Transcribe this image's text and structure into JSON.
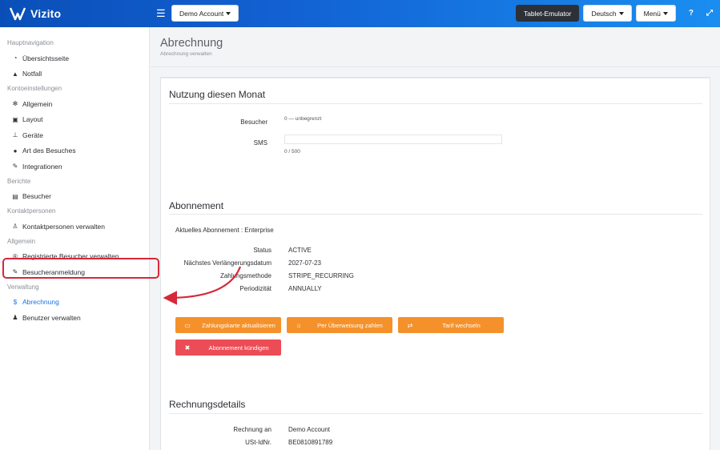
{
  "header": {
    "brand": "Vizito",
    "account_button": "Demo Account",
    "tablet_emulator": "Tablet-Emulator",
    "language": "Deutsch",
    "menu": "Menü",
    "help_icon": "?",
    "expand_icon": "⤢"
  },
  "sidebar": {
    "sections": [
      {
        "title": "Hauptnavigation",
        "items": [
          {
            "label": "Übersichtsseite",
            "icon": "gauge-icon"
          },
          {
            "label": "Notfall",
            "icon": "warning-icon"
          }
        ]
      },
      {
        "title": "Kontoeinstellungen",
        "items": [
          {
            "label": "Allgemein",
            "icon": "gear-icon"
          },
          {
            "label": "Layout",
            "icon": "image-icon"
          },
          {
            "label": "Geräte",
            "icon": "sitemap-icon"
          },
          {
            "label": "Art des Besuches",
            "icon": "users-icon"
          },
          {
            "label": "Integrationen",
            "icon": "plug-icon"
          }
        ]
      },
      {
        "title": "Berichte",
        "items": [
          {
            "label": "Besucher",
            "icon": "book-icon"
          }
        ]
      },
      {
        "title": "Kontaktpersonen",
        "items": [
          {
            "label": "Kontaktpersonen verwalten",
            "icon": "person-icon"
          }
        ]
      },
      {
        "title": "Allgemein",
        "items": [
          {
            "label": "Registrierte Besucher verwalten",
            "icon": "registered-icon"
          },
          {
            "label": "Besucheranmeldung",
            "icon": "pen-icon"
          }
        ]
      },
      {
        "title": "Verwaltung",
        "items": [
          {
            "label": "Abrechnung",
            "icon": "dollar-icon"
          },
          {
            "label": "Benutzer verwalten",
            "icon": "user-cog-icon"
          }
        ]
      }
    ]
  },
  "page": {
    "title": "Abrechnung",
    "subtitle": "Abrechnung verwalten"
  },
  "usage": {
    "title": "Nutzung diesen Monat",
    "visitors_label": "Besucher",
    "visitors_value": "0 — unbegrenzt",
    "sms_label": "SMS",
    "sms_value": "0 / 500",
    "sms_fraction": 0
  },
  "subscription": {
    "title": "Abonnement",
    "current": "Aktuelles Abonnement : Enterprise",
    "rows": [
      {
        "label": "Status",
        "value": "ACTIVE"
      },
      {
        "label": "Nächstes Verlängerungsdatum",
        "value": "2027-07-23"
      },
      {
        "label": "Zahlungsmethode",
        "value": "STRIPE_RECURRING"
      },
      {
        "label": "Periodizität",
        "value": "ANNUALLY"
      }
    ],
    "buttons": {
      "update_card": "Zahlungskarte aktualisieren",
      "bank_transfer": "Per Überweisung zahlen",
      "change_plan": "Tarif wechseln",
      "cancel": "Abonnement kündigen"
    }
  },
  "invoice": {
    "title": "Rechnungsdetails",
    "rows": [
      {
        "label": "Rechnung an",
        "value": "Demo Account"
      },
      {
        "label": "USt-IdNr.",
        "value": "BE0810891789"
      }
    ]
  },
  "colors": {
    "topbar": "#1261d3",
    "accent": "#1a73e8",
    "orange": "#f5912a",
    "red": "#ec4c55",
    "highlight": "#d62839"
  }
}
